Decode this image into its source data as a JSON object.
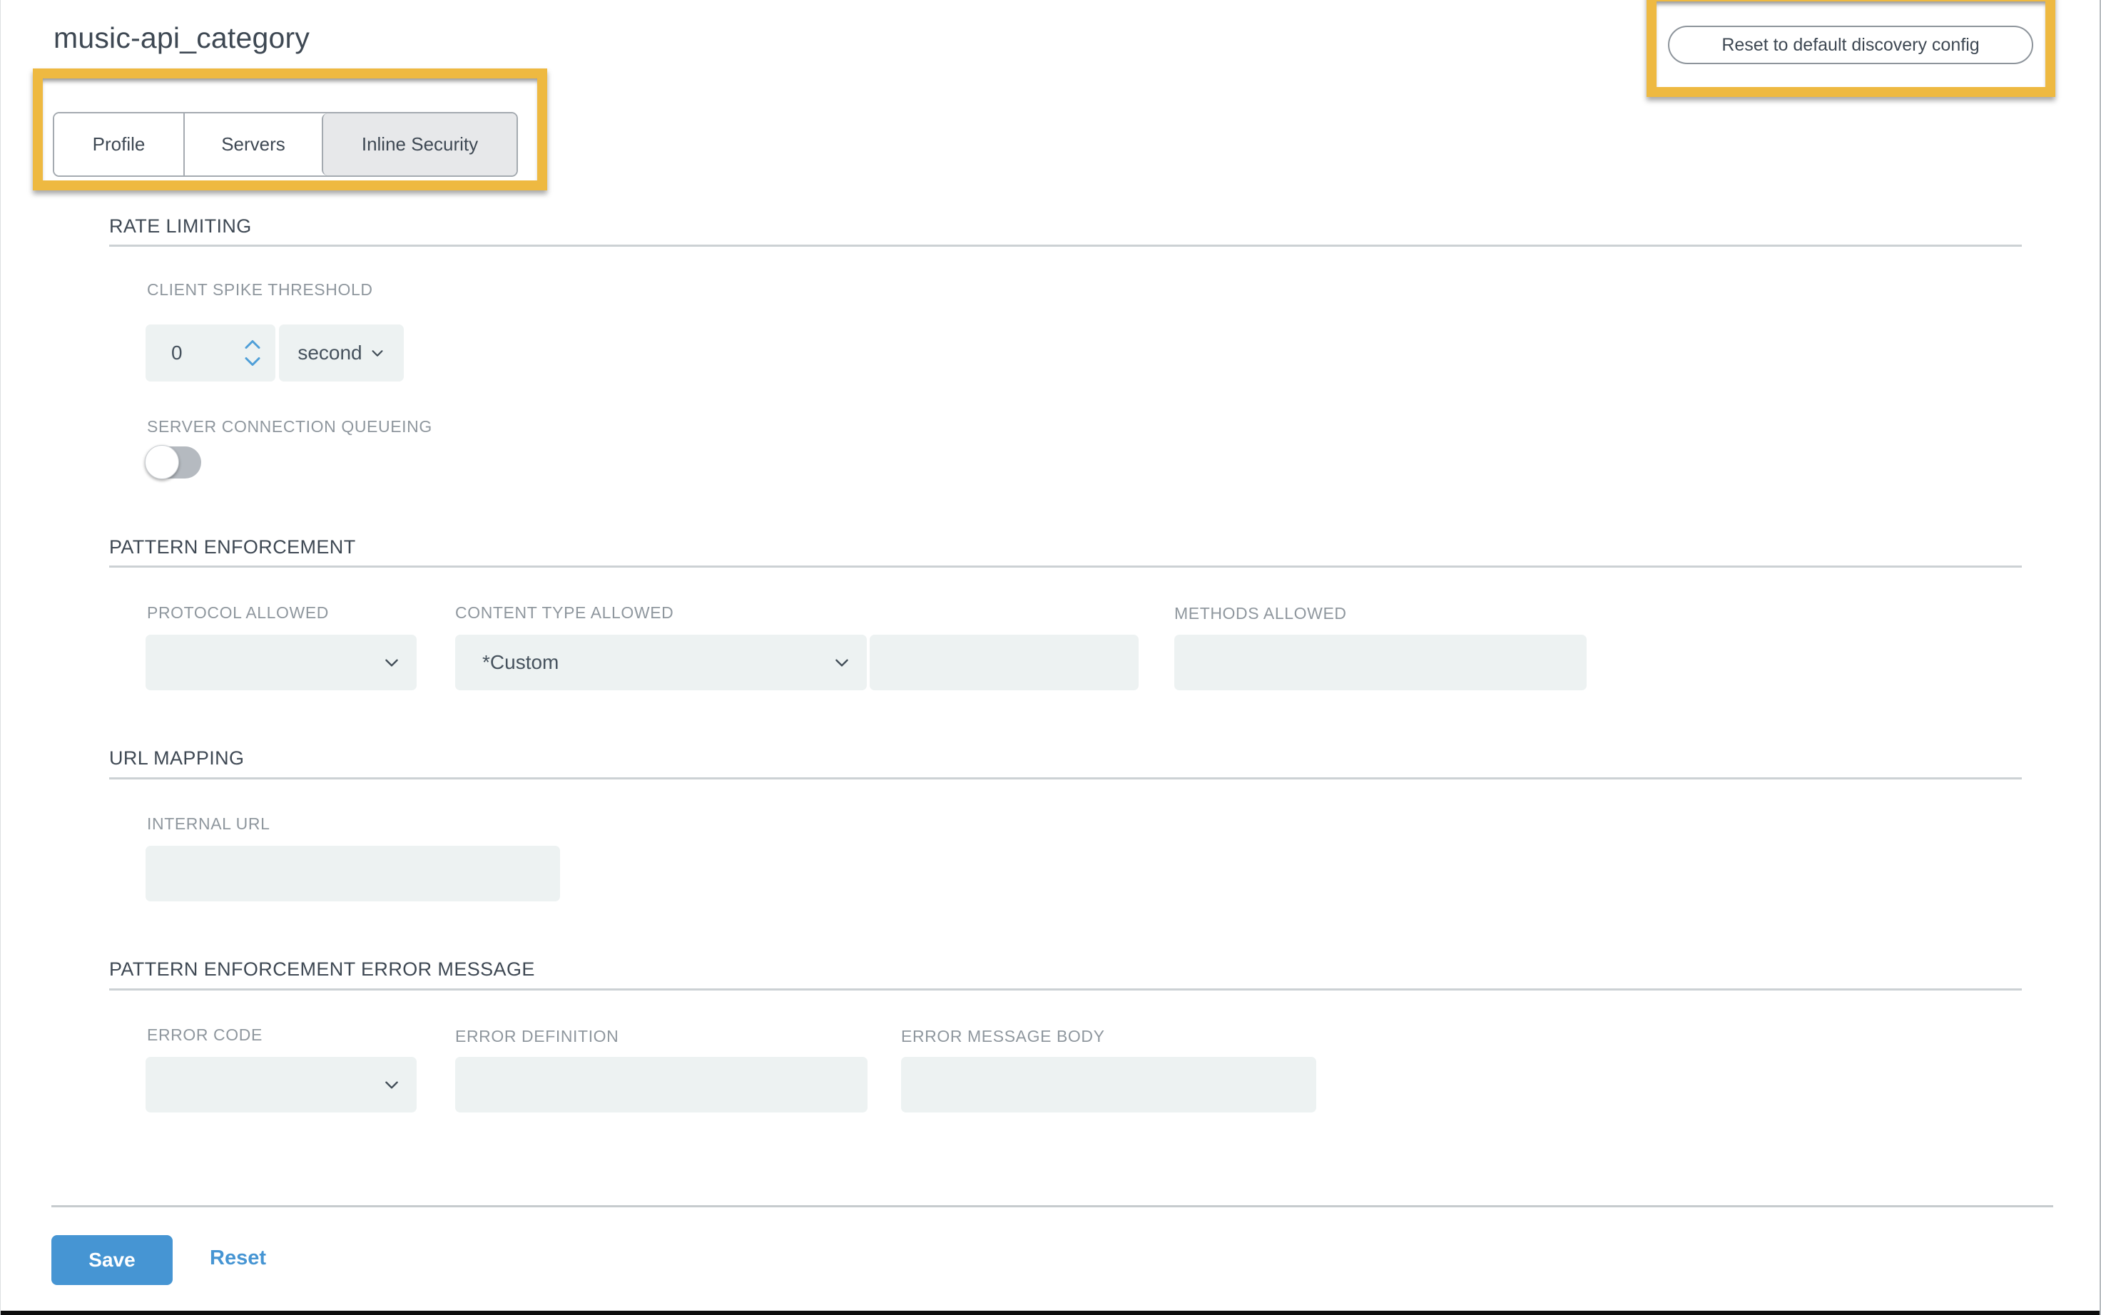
{
  "page": {
    "title": "music-api_category"
  },
  "tabs": [
    {
      "label": "Profile",
      "active": false
    },
    {
      "label": "Servers",
      "active": false
    },
    {
      "label": "Inline Security",
      "active": true
    }
  ],
  "actions": {
    "reset_discovery": "Reset to default discovery config"
  },
  "sections": {
    "rate_limiting": {
      "title": "RATE LIMITING",
      "client_spike_threshold": {
        "label": "CLIENT SPIKE THRESHOLD",
        "value": "0",
        "unit": "second"
      },
      "server_connection_queueing": {
        "label": "SERVER CONNECTION QUEUEING",
        "enabled": false
      }
    },
    "pattern_enforcement": {
      "title": "PATTERN ENFORCEMENT",
      "protocol_allowed": {
        "label": "PROTOCOL ALLOWED",
        "value": ""
      },
      "content_type_allowed": {
        "label": "CONTENT TYPE ALLOWED",
        "value": "*Custom",
        "custom_value": ""
      },
      "methods_allowed": {
        "label": "METHODS ALLOWED",
        "value": ""
      }
    },
    "url_mapping": {
      "title": "URL MAPPING",
      "internal_url": {
        "label": "INTERNAL URL",
        "value": ""
      }
    },
    "error_message": {
      "title": "PATTERN ENFORCEMENT ERROR MESSAGE",
      "error_code": {
        "label": "ERROR CODE",
        "value": ""
      },
      "error_definition": {
        "label": "ERROR DEFINITION",
        "value": ""
      },
      "error_message_body": {
        "label": "ERROR MESSAGE BODY",
        "value": ""
      }
    }
  },
  "footer": {
    "save": "Save",
    "reset": "Reset"
  },
  "icons": {
    "dropdown": "chevron-down-icon",
    "stepper_up": "chevron-up-icon",
    "stepper_down": "chevron-down-icon"
  },
  "colors": {
    "accent_yellow": "#eeb941",
    "primary_blue": "#4695d3",
    "field_bg": "#edf2f2",
    "text_dark": "#3e4853",
    "label_gray": "#8f979e",
    "toggle_track": "#b5bac0",
    "stepper_blue": "#4f9fd8"
  }
}
